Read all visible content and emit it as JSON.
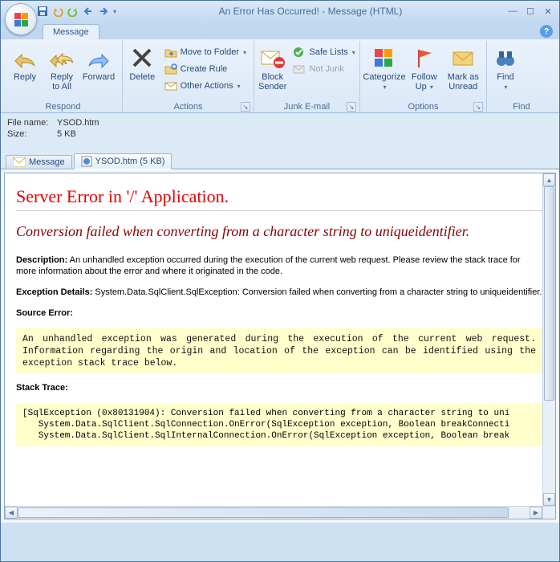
{
  "title": "An Error Has Occurred! - Message (HTML)",
  "tab": "Message",
  "ribbon": {
    "respond": {
      "label": "Respond",
      "reply": "Reply",
      "reply_all": "Reply\nto All",
      "forward": "Forward"
    },
    "actions": {
      "label": "Actions",
      "delete": "Delete",
      "move": "Move to Folder",
      "create_rule": "Create Rule",
      "other": "Other Actions"
    },
    "junk": {
      "label": "Junk E-mail",
      "block": "Block\nSender",
      "safe": "Safe Lists",
      "not_junk": "Not Junk"
    },
    "options": {
      "label": "Options",
      "categorize": "Categorize",
      "follow": "Follow\nUp",
      "mark": "Mark as\nUnread"
    },
    "find": {
      "label": "Find",
      "find": "Find"
    }
  },
  "info": {
    "file_name_label": "File name:",
    "file_name": "YSOD.htm",
    "size_label": "Size:",
    "size": "5 KB"
  },
  "view_tabs": {
    "message": "Message",
    "attachment": "YSOD.htm (5 KB)"
  },
  "error_page": {
    "h1": "Server Error in '/' Application.",
    "h2": "Conversion failed when converting from a character string to uniqueidentifier.",
    "desc_label": "Description:",
    "desc": "An unhandled exception occurred during the execution of the current web request. Please review the stack trace for more information about the error and where it originated in the code.",
    "exc_label": "Exception Details:",
    "exc": "System.Data.SqlClient.SqlException: Conversion failed when converting from a character string to uniqueidentifier.",
    "src_label": "Source Error:",
    "src_box": "An unhandled exception was generated during the execution of the current web request. Information regarding the origin and location of the exception can be identified using the exception stack trace below.",
    "stack_label": "Stack Trace:",
    "stack_box": "[SqlException (0x80131904): Conversion failed when converting from a character string to uni\n   System.Data.SqlClient.SqlConnection.OnError(SqlException exception, Boolean breakConnecti\n   System.Data.SqlClient.SqlInternalConnection.OnError(SqlException exception, Boolean break"
  }
}
